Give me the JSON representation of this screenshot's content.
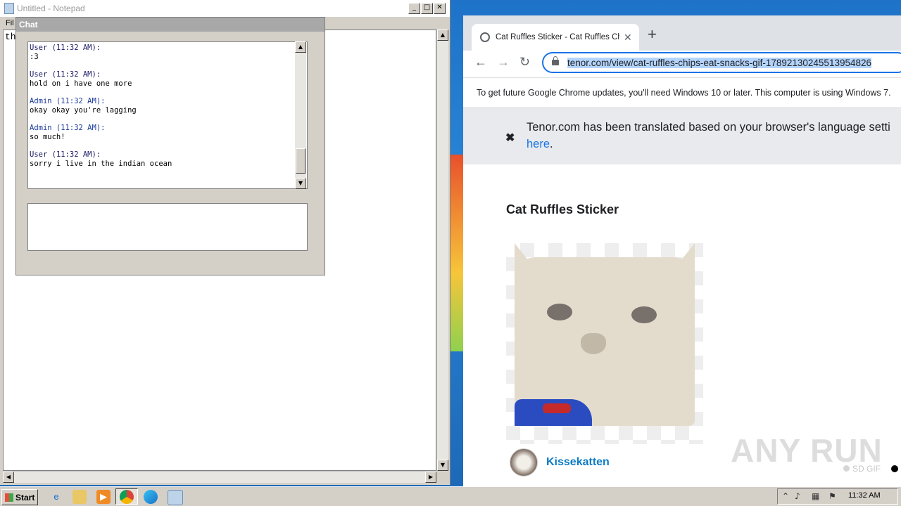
{
  "notepad": {
    "title": "Untitled - Notepad",
    "menu_first": "Fil",
    "content": "th",
    "controls": {
      "minimize": "_",
      "maximize": "□",
      "close": "✕"
    }
  },
  "chat": {
    "title": "Chat",
    "messages": [
      {
        "from": "User (11:32 AM):",
        "text": ":3",
        "role": "user"
      },
      {
        "from": "User (11:32 AM):",
        "text": "hold on i have one more",
        "role": "user"
      },
      {
        "from": "Admin (11:32 AM):",
        "text": "okay okay you're lagging",
        "role": "admin"
      },
      {
        "from": "Admin (11:32 AM):",
        "text": "so much!",
        "role": "admin"
      },
      {
        "from": "User (11:32 AM):",
        "text": "sorry i live in the indian ocean",
        "role": "user"
      }
    ]
  },
  "browser": {
    "tab_title": "Cat Ruffles Sticker - Cat Ruffles Chips",
    "tab_close": "✕",
    "new_tab": "+",
    "nav": {
      "back": "←",
      "forward": "→",
      "reload": "↻"
    },
    "url": "tenor.com/view/cat-ruffles-chips-eat-snacks-gif-17892130245513954826",
    "infobar": "To get future Google Chrome updates, you'll need Windows 10 or later. This computer is using Windows 7.",
    "translate": {
      "close": "✖",
      "line1": "Tenor.com has been translated based on your browser's language setti",
      "link": "here",
      "period": "."
    },
    "page": {
      "title": "Cat Ruffles Sticker",
      "author": "Kissekatten",
      "sd_gif": "SD GIF",
      "watermark": "ANY RUN"
    }
  },
  "taskbar": {
    "start": "Start",
    "clock": "11:32 AM",
    "tray_up": "⌃"
  },
  "colors": {
    "chrome_accent": "#1a73e8",
    "author_link": "#0c7bc4",
    "taskbar": "#d4d0c8"
  }
}
